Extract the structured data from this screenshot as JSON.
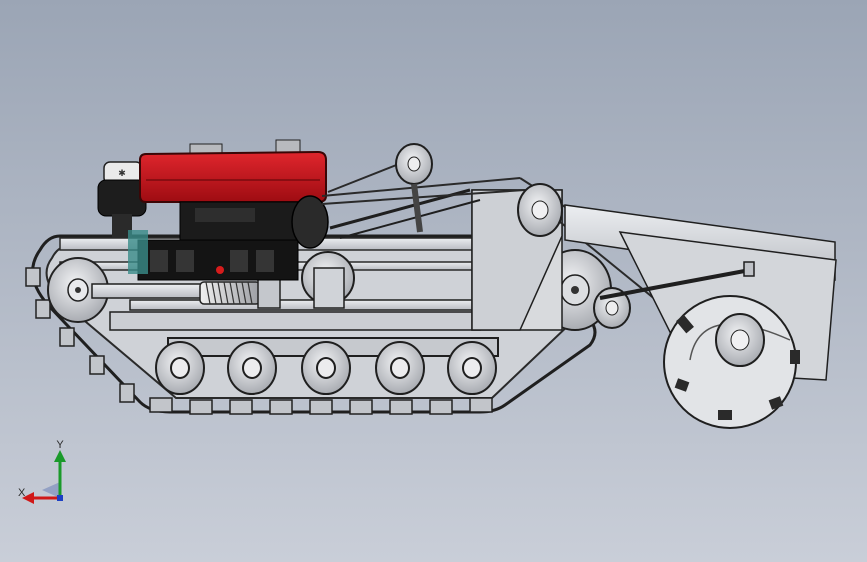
{
  "viewport": {
    "background_top": "#9ba5b5",
    "background_bottom": "#c9ced8"
  },
  "model": {
    "engine_color": "#c8121b",
    "steel_color": "#d4d6da",
    "dark_color": "#1c1c1c"
  },
  "triad": {
    "x_label": "X",
    "y_label": "Y",
    "x_color": "#d01818",
    "y_color": "#1a9a2a",
    "z_color": "#1c3fc4"
  }
}
